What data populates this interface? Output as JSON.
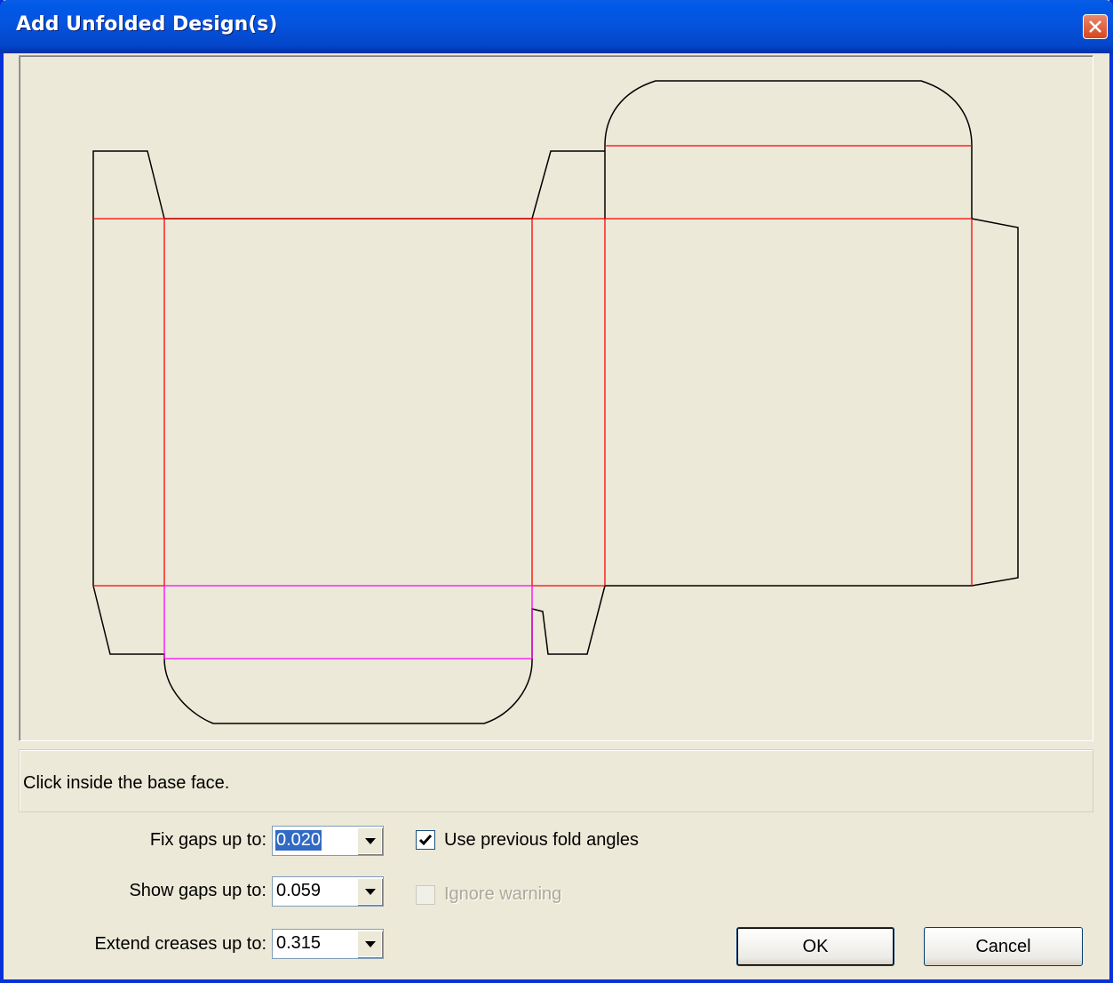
{
  "window": {
    "title": "Add Unfolded Design(s)"
  },
  "status": {
    "message": "Click inside the base face."
  },
  "options": {
    "fix_gaps": {
      "label": "Fix gaps up to:",
      "value": "0.020"
    },
    "show_gaps": {
      "label": "Show gaps up to:",
      "value": "0.059"
    },
    "extend_creases": {
      "label": "Extend creases up to:",
      "value": "0.315"
    },
    "use_previous_fold_angles": {
      "label": "Use previous fold angles",
      "checked": true
    },
    "ignore_warning": {
      "label": "Ignore warning",
      "checked": false,
      "enabled": false
    }
  },
  "buttons": {
    "ok": "OK",
    "cancel": "Cancel"
  },
  "colors": {
    "cut_line": "#000000",
    "crease_line": "#FF0000",
    "selected_crease": "#FF00FF",
    "titlebar": "#0058E6"
  }
}
